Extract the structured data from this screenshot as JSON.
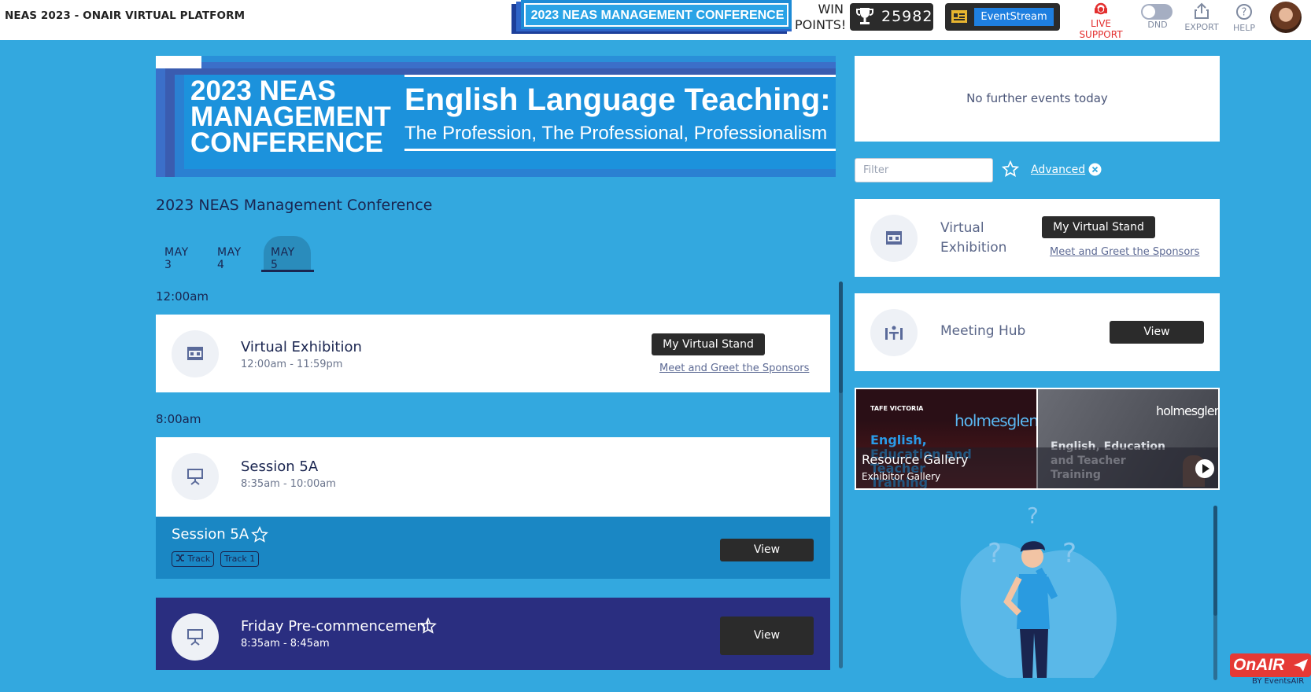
{
  "app": {
    "title": "NEAS 2023 - ONAIR VIRTUAL PLATFORM"
  },
  "header": {
    "conference_badge": "2023 NEAS MANAGEMENT CONFERENCE",
    "win_points_label": "WIN POINTS!",
    "points_value": "25982",
    "eventstream_label": "EventStream",
    "live_support_label": "LIVE SUPPORT",
    "dnd_label": "DND",
    "export_label": "EXPORT",
    "help_label": "HELP"
  },
  "banner": {
    "left_title_line1": "2023 NEAS",
    "left_title_line2": "MANAGEMENT",
    "left_title_line3": "CONFERENCE",
    "right_title": "English Language Teaching:",
    "right_subtitle": "The Profession, The Professional, Professionalism"
  },
  "conference_name": "2023 NEAS Management Conference",
  "tabs": [
    {
      "label": "MAY 3",
      "active": false
    },
    {
      "label": "MAY 4",
      "active": false
    },
    {
      "label": "MAY 5",
      "active": true
    }
  ],
  "schedule": {
    "groups": [
      {
        "time": "12:00am",
        "events": [
          {
            "title": "Virtual Exhibition",
            "time_range": "12:00am - 11:59pm",
            "button_label": "My Virtual Stand",
            "link_label": "Meet and Greet the Sponsors"
          }
        ]
      },
      {
        "time": "8:00am",
        "events": [
          {
            "title": "Session 5A",
            "time_range": "8:35am - 10:00am",
            "session_title": "Session 5A",
            "tags": [
              "Track",
              "Track 1"
            ],
            "button_label": "View"
          },
          {
            "title": "Friday Pre-commencement",
            "time_range": "8:35am - 8:45am",
            "button_label": "View"
          }
        ]
      }
    ]
  },
  "sidebar": {
    "no_events_text": "No further events today",
    "filter_placeholder": "Filter",
    "advanced_label": "Advanced",
    "virtual_exhibition": {
      "title": "Virtual Exhibition",
      "button_label": "My Virtual Stand",
      "link_label": "Meet and Greet the Sponsors"
    },
    "meeting_hub": {
      "title": "Meeting Hub",
      "button_label": "View"
    },
    "gallery": {
      "title": "Resource Gallery",
      "subtitle": "Exhibitor Gallery",
      "left_brand": "holmesglen",
      "left_logo": "TAFE VICTORIA",
      "left_tagline": "English, Education and Teacher Training",
      "right_brand": "holmesglen",
      "right_tagline": "English, Education and Teacher Training"
    }
  },
  "footer": {
    "brand": "OnAIR",
    "by_label": "BY EventsAIR"
  },
  "colors": {
    "page_bg": "#33a8df",
    "navy": "#1a2550",
    "session_bar": "#1a87c4",
    "friday_card": "#2a2e80",
    "dark_button": "#2b2b2b",
    "live_red": "#e32f2f"
  }
}
